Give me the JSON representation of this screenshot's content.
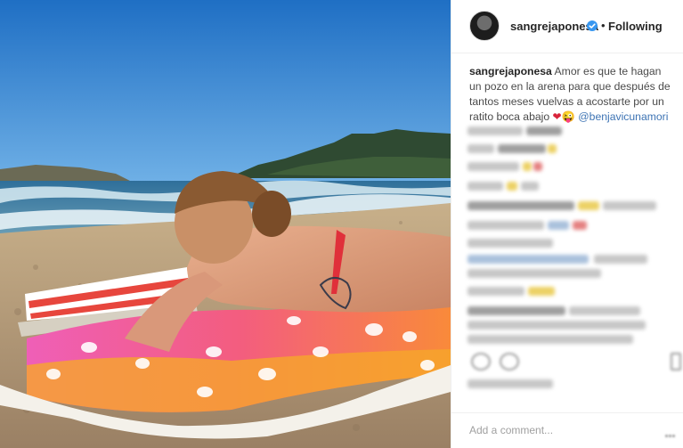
{
  "post": {
    "username": "sangrejaponesa",
    "follow_label": "Following",
    "separator": "•",
    "verified_icon": "verified-badge-icon",
    "caption_user": "sangrejaponesa",
    "caption_text": "Amor es que te hagan un pozo en la arena para que después de tantos meses vuelvas a acostarte por un ratito boca abajo",
    "caption_emoji": "❤😜",
    "caption_mention": "@benjavicunamori",
    "comment_placeholder": "Add a comment..."
  },
  "colors": {
    "text": "#262626",
    "mention": "#3e74b4",
    "verified": "#3897f0",
    "border": "#efefef"
  }
}
